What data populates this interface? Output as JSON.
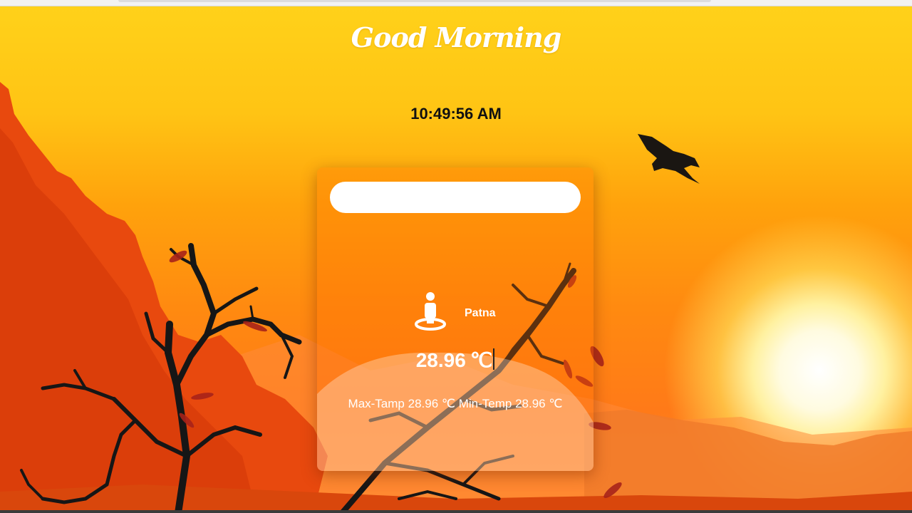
{
  "greeting": "Good Morning",
  "clock": "10:49:56 AM",
  "search": {
    "value": "",
    "placeholder": ""
  },
  "weather": {
    "location_icon": "person-location-icon",
    "city": "Patna",
    "temperature": "28.96",
    "temperature_unit": "℃",
    "max_label": "Max-Tamp",
    "max_value": "28.96",
    "max_unit": "℃",
    "min_label": "Min-Temp",
    "min_value": "28.96",
    "min_unit": "℃"
  },
  "colors": {
    "sky_top": "#ffd21a",
    "sky_bottom": "#ff7a18",
    "mountain": "#e8450c",
    "silhouette": "#161616",
    "text_light": "#ffffff",
    "text_dark": "#111111"
  },
  "background": {
    "scene": "sunset landscape",
    "icons": [
      "sun-icon",
      "eagle-icon",
      "tree-silhouette-icon"
    ]
  }
}
